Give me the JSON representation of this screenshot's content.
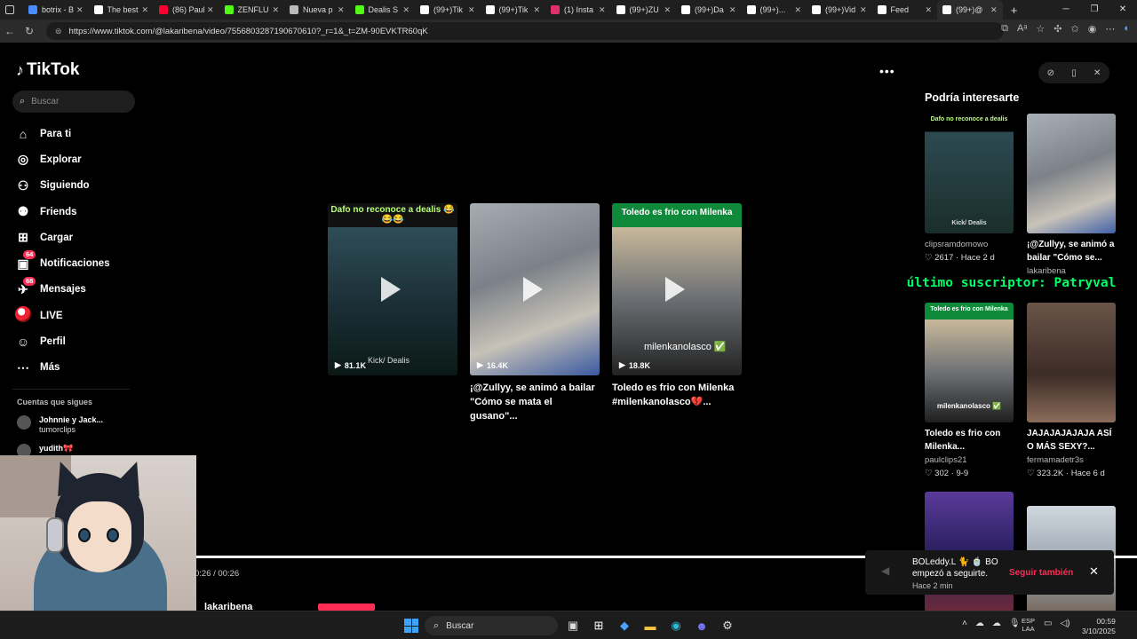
{
  "browser": {
    "tabs": [
      {
        "title": "botrix - B",
        "icon": "search-icon",
        "color": "#4a8cff"
      },
      {
        "title": "The best",
        "icon": "chatgpt-icon",
        "color": "#ffffff"
      },
      {
        "title": "(86) Paul",
        "icon": "youtube-icon",
        "color": "#ff0033"
      },
      {
        "title": "ZENFLUE",
        "icon": "kick-icon",
        "color": "#53fc18"
      },
      {
        "title": "Nueva p",
        "icon": "page-icon",
        "color": "#bbbbbb"
      },
      {
        "title": "Dealis S",
        "icon": "kick-icon",
        "color": "#53fc18"
      },
      {
        "title": "(99+)Tik",
        "icon": "tiktok-icon",
        "color": "#ffffff"
      },
      {
        "title": "(99+)Tik",
        "icon": "tiktok-icon",
        "color": "#ffffff"
      },
      {
        "title": "(1) Insta",
        "icon": "instagram-icon",
        "color": "#e1306c"
      },
      {
        "title": "(99+)ZU",
        "icon": "tiktok-icon",
        "color": "#ffffff"
      },
      {
        "title": "(99+)Da",
        "icon": "tiktok-icon",
        "color": "#ffffff"
      },
      {
        "title": "(99+)...",
        "icon": "tiktok-icon",
        "color": "#ffffff"
      },
      {
        "title": "(99+)Vid",
        "icon": "tiktok-icon",
        "color": "#ffffff"
      },
      {
        "title": "Feed",
        "icon": "tiktok-icon",
        "color": "#ffffff"
      },
      {
        "title": "(99+)@",
        "icon": "tiktok-icon",
        "color": "#ffffff"
      }
    ],
    "new_tab": "+",
    "url": "https://www.tiktok.com/@lakaribena/video/7556803287190670610?_r=1&_t=ZM-90EVKTR60qK"
  },
  "sidebar": {
    "logo": "TikTok",
    "search_placeholder": "Buscar",
    "items": [
      {
        "label": "Para ti",
        "icon": "home-icon",
        "glyph": "⌂"
      },
      {
        "label": "Explorar",
        "icon": "compass-icon",
        "glyph": "◎"
      },
      {
        "label": "Siguiendo",
        "icon": "following-icon",
        "glyph": "⚇"
      },
      {
        "label": "Friends",
        "icon": "friends-icon",
        "glyph": "⚉"
      },
      {
        "label": "Cargar",
        "icon": "upload-icon",
        "glyph": "⊞"
      },
      {
        "label": "Notificaciones",
        "icon": "inbox-icon",
        "glyph": "▣",
        "badge": "64"
      },
      {
        "label": "Mensajes",
        "icon": "messages-icon",
        "glyph": "✈",
        "badge": "68"
      },
      {
        "label": "LIVE",
        "icon": "live-icon",
        "glyph": ""
      },
      {
        "label": "Perfil",
        "icon": "profile-icon",
        "glyph": "☺"
      },
      {
        "label": "Más",
        "icon": "more-icon",
        "glyph": "⋯"
      }
    ],
    "following_title": "Cuentas que sigues",
    "following": [
      {
        "name": "Johnnie y Jack...",
        "sub": "tumorclips"
      },
      {
        "name": "yudith🎀",
        "sub": ""
      }
    ]
  },
  "center_videos": [
    {
      "top_caption": "Dafo no reconoce a dealis 😂😂😂",
      "views": "81.1K",
      "overlay": "Kick/ Dealis",
      "caption": "",
      "bg": "#233a3a"
    },
    {
      "top_caption": "",
      "views": "16.4K",
      "overlay": "",
      "caption": "¡@Zullyy, se animó a bailar \"Cómo se mata el gusano\"...",
      "bg": "#8a8f96"
    },
    {
      "top_caption": "Toledo es frio con Milenka",
      "views": "18.8K",
      "overlay": "milenkanolasco ✅",
      "caption": "Toledo es frio con Milenka #milenkanolasco💔...",
      "bg": "#6a6f74"
    }
  ],
  "right_panel": {
    "title": "Podría interesarte",
    "cards": [
      {
        "overlay_top": "Dafo no reconoce a dealis",
        "overlay_bottom": "Kick/ Dealis",
        "title": "",
        "user": "clipsramdomowo",
        "meta": "♡ 2617 · Hace 2 d",
        "bg": "#2a3b3b"
      },
      {
        "overlay_top": "",
        "overlay_bottom": "",
        "title": "¡@Zullyy, se animó a bailar \"Cómo se...",
        "user": "lakaribena",
        "meta": "",
        "bg": "#8d929a"
      },
      {
        "overlay_top": "Toledo es frio con Milenka",
        "overlay_bottom": "milenkanolasco ✅",
        "title": "Toledo es frio con Milenka...",
        "user": "paulclips21",
        "meta": "♡ 302 · 9-9",
        "bg": "#6b7075"
      },
      {
        "overlay_top": "",
        "overlay_bottom": "",
        "title": "JAJAJAJAJAJA ASÍ O MÁS SEXY?...",
        "user": "fermamadetr3s",
        "meta": "♡ 323.2K · Hace 6 d",
        "bg": "#5a4a42"
      },
      {
        "overlay_top": "",
        "overlay_bottom": "",
        "title": "",
        "user": "",
        "meta": "",
        "bg": "#3a2a5a"
      },
      {
        "overlay_top": "",
        "overlay_bottom": "",
        "title": "",
        "user": "",
        "meta": "",
        "bg": "#9aa4ad"
      }
    ]
  },
  "subscriber_banner": "último suscriptor: Patryval",
  "player": {
    "time": "0:26 / 00:26",
    "author": "lakaribena",
    "progress": 1.0
  },
  "toast": {
    "line1": "BOLeddy.L 🐈 🍵 BO",
    "line2": "empezó a seguirte.",
    "line3": "Hace 2 min",
    "action": "Seguir también"
  },
  "taskbar": {
    "search": "Buscar",
    "lang_1": "ESP",
    "lang_2": "LAA",
    "time": "00:59",
    "date": "3/10/2025"
  }
}
